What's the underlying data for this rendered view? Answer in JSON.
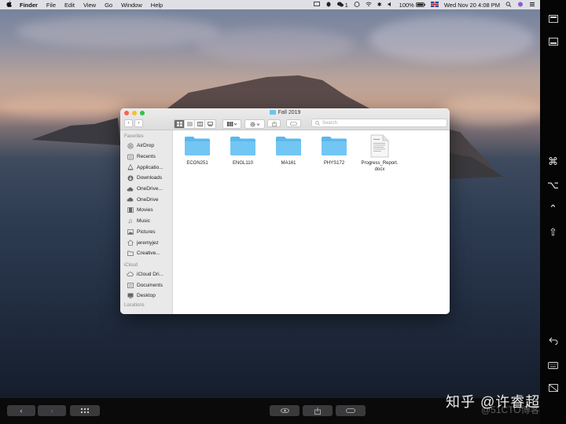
{
  "menubar": {
    "apple": "",
    "app": "Finder",
    "menus": [
      "File",
      "Edit",
      "View",
      "Go",
      "Window",
      "Help"
    ],
    "wechat_count": "1",
    "battery": "100%",
    "datetime": "Wed Nov 20  4:08 PM"
  },
  "window": {
    "title": "Fall 2019",
    "search_placeholder": "Search",
    "sidebar": {
      "favorites_header": "Favorites",
      "favorites": [
        {
          "label": "AirDrop",
          "icon": "airdrop-icon"
        },
        {
          "label": "Recents",
          "icon": "recents-icon"
        },
        {
          "label": "Applicatio...",
          "icon": "applications-icon"
        },
        {
          "label": "Downloads",
          "icon": "downloads-icon"
        },
        {
          "label": "OneDrive...",
          "icon": "cloud-icon"
        },
        {
          "label": "OneDrive",
          "icon": "cloud-icon"
        },
        {
          "label": "Movies",
          "icon": "movies-icon"
        },
        {
          "label": "Music",
          "icon": "music-icon"
        },
        {
          "label": "Pictures",
          "icon": "pictures-icon"
        },
        {
          "label": "jeremyjez",
          "icon": "home-icon"
        },
        {
          "label": "Creative...",
          "icon": "folder-icon"
        }
      ],
      "icloud_header": "iCloud",
      "icloud": [
        {
          "label": "iCloud Dri...",
          "icon": "icloud-icon"
        },
        {
          "label": "Documents",
          "icon": "documents-icon"
        },
        {
          "label": "Desktop",
          "icon": "desktop-icon"
        }
      ],
      "locations_header": "Locations"
    },
    "files": [
      {
        "name": "ECON251",
        "kind": "folder"
      },
      {
        "name": "ENGL110",
        "kind": "folder"
      },
      {
        "name": "MA161",
        "kind": "folder"
      },
      {
        "name": "PHYS172",
        "kind": "folder"
      },
      {
        "name": "Progress_Report.\ndocx",
        "kind": "document"
      }
    ]
  },
  "touchbar": [
    "⌘",
    "⌥",
    "⌃",
    "⇧"
  ],
  "watermark": "知乎 @许睿超",
  "watermark_faint": "@51CTO博客",
  "colors": {
    "folder": "#5bb8ec",
    "selection": "#6e6e6e"
  }
}
